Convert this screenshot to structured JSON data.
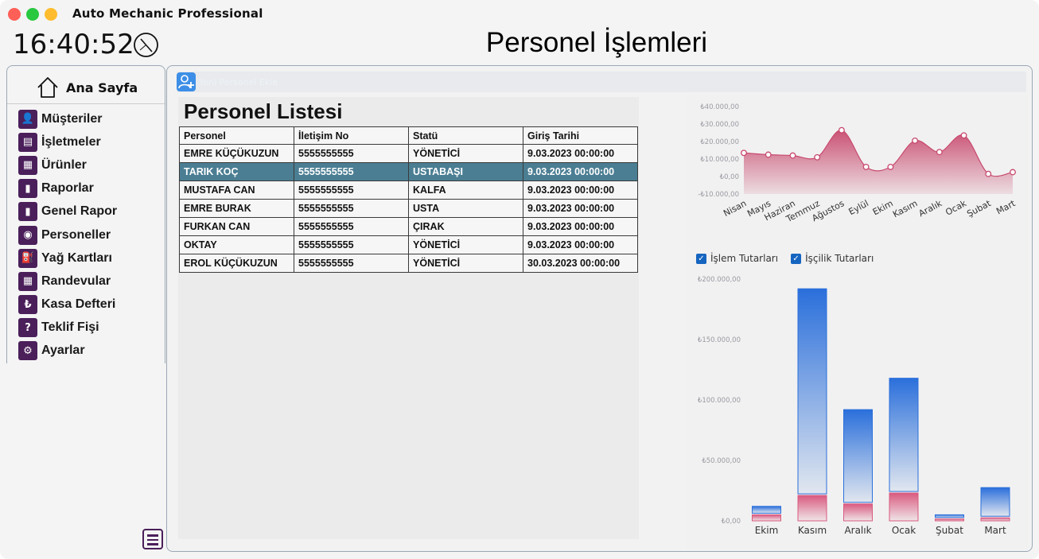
{
  "app": {
    "title": "Auto Mechanic Professional",
    "clock": "16:40:52"
  },
  "header": {
    "page_title": "Personel İşlemleri"
  },
  "sidebar": {
    "home_label": "Ana Sayfa",
    "items": [
      {
        "label": "Müşteriler",
        "icon": "customer-icon",
        "glyph": "👤"
      },
      {
        "label": "İşletmeler",
        "icon": "business-icon",
        "glyph": "▤"
      },
      {
        "label": "Ürünler",
        "icon": "products-icon",
        "glyph": "▦"
      },
      {
        "label": "Raporlar",
        "icon": "reports-icon",
        "glyph": "▮"
      },
      {
        "label": "Genel Rapor",
        "icon": "general-report-icon",
        "glyph": "▮"
      },
      {
        "label": "Personeller",
        "icon": "staff-icon",
        "glyph": "◉"
      },
      {
        "label": "Yağ Kartları",
        "icon": "oil-card-icon",
        "glyph": "⛽"
      },
      {
        "label": "Randevular",
        "icon": "calendar-icon",
        "glyph": "▦"
      },
      {
        "label": "Kasa Defteri",
        "icon": "lira-icon",
        "glyph": "₺"
      },
      {
        "label": "Teklif Fişi",
        "icon": "question-icon",
        "glyph": "?"
      },
      {
        "label": "Ayarlar",
        "icon": "settings-icon",
        "glyph": "⚙"
      }
    ]
  },
  "toolbar": {
    "add_label": "Yeni Personel Ekle"
  },
  "list": {
    "title": "Personel Listesi",
    "columns": [
      "Personel",
      "İletişim No",
      "Statü",
      "Giriş Tarihi"
    ],
    "rows": [
      [
        "EMRE KÜÇÜKUZUN",
        "5555555555",
        "YÖNETİCİ",
        "9.03.2023 00:00:00"
      ],
      [
        "TARIK KOÇ",
        "5555555555",
        "USTABAŞI",
        "9.03.2023 00:00:00"
      ],
      [
        "MUSTAFA CAN",
        "5555555555",
        "KALFA",
        "9.03.2023 00:00:00"
      ],
      [
        "EMRE BURAK",
        "5555555555",
        "USTA",
        "9.03.2023 00:00:00"
      ],
      [
        "FURKAN CAN",
        "5555555555",
        "ÇIRAK",
        "9.03.2023 00:00:00"
      ],
      [
        "OKTAY",
        "5555555555",
        "YÖNETİCİ",
        "9.03.2023 00:00:00"
      ],
      [
        "EROL KÜÇÜKUZUN",
        "5555555555",
        "YÖNETİCİ",
        "30.03.2023 00:00:00"
      ]
    ],
    "selected_index": 1
  },
  "chart_data": [
    {
      "type": "area",
      "categories": [
        "Nisan",
        "Mayıs",
        "Haziran",
        "Temmuz",
        "Ağustos",
        "Eylül",
        "Ekim",
        "Kasım",
        "Aralık",
        "Ocak",
        "Şubat",
        "Mart"
      ],
      "values": [
        13500,
        12500,
        12000,
        11000,
        26500,
        5500,
        5500,
        20500,
        14000,
        23500,
        1500,
        2500
      ],
      "ylim": [
        -10000,
        40000
      ],
      "yticks": [
        "₺40.000,00",
        "₺30.000,00",
        "₺20.000,00",
        "₺10.000,00",
        "₺0,00",
        "-₺10.000,00"
      ],
      "color": "#c8496e"
    },
    {
      "type": "bar",
      "categories": [
        "Ekim",
        "Kasım",
        "Aralık",
        "Ocak",
        "Şubat",
        "Mart"
      ],
      "series": [
        {
          "name": "İşlem Tutarları",
          "values": [
            7000,
            171000,
            78000,
            95000,
            3500,
            25000
          ],
          "color": "#2a6fdb"
        },
        {
          "name": "İşçilik Tutarları",
          "values": [
            5000,
            21000,
            14000,
            23000,
            1500,
            2500
          ],
          "color": "#d95a80"
        }
      ],
      "ylim": [
        0,
        200000
      ],
      "yticks": [
        "₺200.000,00",
        "₺150.000,00",
        "₺100.000,00",
        "₺50.000,00",
        "₺0,00"
      ],
      "legend": "top-left"
    }
  ]
}
